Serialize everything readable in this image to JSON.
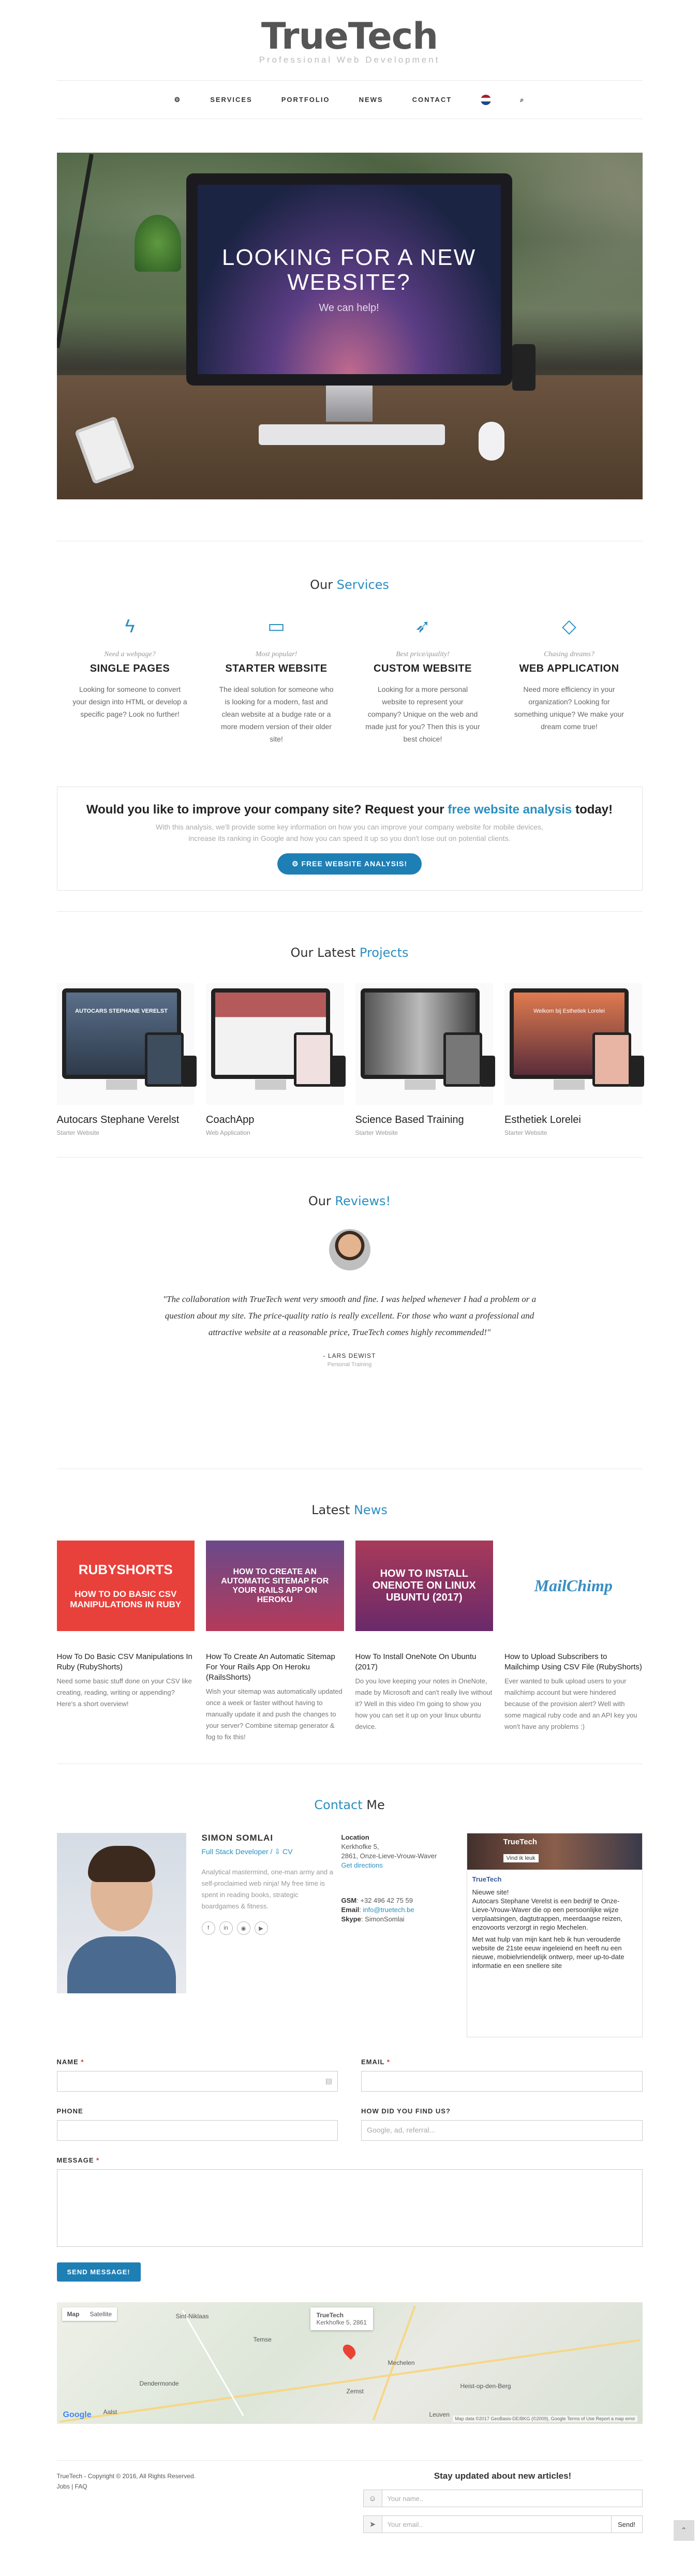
{
  "brand": {
    "logo": "TrueTech",
    "tagline": "Professional Web Development"
  },
  "nav": {
    "items": [
      "SERVICES",
      "PORTFOLIO",
      "NEWS",
      "CONTACT"
    ]
  },
  "hero": {
    "title": "LOOKING FOR A NEW WEBSITE?",
    "subtitle": "We can help!"
  },
  "services": {
    "title": "Our",
    "title_hl": "Services",
    "items": [
      {
        "icon": "bolt-icon",
        "sub": "Need a webpage?",
        "title": "SINGLE PAGES",
        "text": "Looking for someone to convert your design into HTML or develop a specific page? Look no further!"
      },
      {
        "icon": "monitor-icon",
        "sub": "Most popular!",
        "title": "STARTER WEBSITE",
        "text": "The ideal solution for someone who is looking for a modern, fast and clean website at a budge rate or a more modern version of their older site!"
      },
      {
        "icon": "rocket-icon",
        "sub": "Best price/quality!",
        "title": "CUSTOM WEBSITE",
        "text": "Looking for a more personal website to represent your company? Unique on the web and made just for you? Then this is your best choice!"
      },
      {
        "icon": "diamond-icon",
        "sub": "Chasing dreams?",
        "title": "WEB APPLICATION",
        "text": "Need more efficiency in your organization? Looking for something unique? We make your dream come true!"
      }
    ]
  },
  "cta": {
    "q1": "Would you like to improve your company site? Request your",
    "q_hl": "free website analysis",
    "q2": "today!",
    "desc": "With this analysis, we'll provide some key information on how you can improve your company website for mobile devices, increase its ranking in Google and how you can speed it up so you don't lose out on potential clients.",
    "button": "FREE WEBSITE ANALYSIS!"
  },
  "projects": {
    "title": "Our Latest",
    "title_hl": "Projects",
    "items": [
      {
        "name": "Autocars Stephane Verelst",
        "cat": "Starter Website",
        "screen": "AUTOCARS STEPHANE VERELST"
      },
      {
        "name": "CoachApp",
        "cat": "Web Application",
        "screen": ""
      },
      {
        "name": "Science Based Training",
        "cat": "Starter Website",
        "screen": ""
      },
      {
        "name": "Esthetiek Lorelei",
        "cat": "Starter Website",
        "screen": "Welkom bij Esthetiek Lorelei"
      }
    ]
  },
  "reviews": {
    "title": "Our",
    "title_hl": "Reviews!",
    "quote": "\"The collaboration with TrueTech went very smooth and fine. I was helped whenever I had a problem or a question about my site. The price-quality ratio is really excellent. For those who want a professional and attractive website at a reasonable price, TrueTech comes highly recommended!\"",
    "name": "- LARS DEWIST",
    "role": "Personal Training"
  },
  "news": {
    "title": "Latest",
    "title_hl": "News",
    "items": [
      {
        "img1": "RUBYSHORTS",
        "img2": "HOW TO DO BASIC CSV MANIPULATIONS IN RUBY",
        "title": "How To Do Basic CSV Manipulations In Ruby (RubyShorts)",
        "text": "Need some basic stuff done on your CSV like creating, reading, writing or appending? Here's a short overview!"
      },
      {
        "img1": "HOW TO CREATE AN AUTOMATIC SITEMAP FOR YOUR RAILS APP ON HEROKU",
        "img2": "",
        "title": "How To Create An Automatic Sitemap For Your Rails App On Heroku (RailsShorts)",
        "text": "Wish your sitemap was automatically updated once a week or faster without having to manually update it and push the changes to your server? Combine sitemap generator & fog to fix this!"
      },
      {
        "img1": "HOW TO INSTALL ONENOTE ON LINUX UBUNTU (2017)",
        "img2": "",
        "title": "How To Install OneNote On Ubuntu (2017)",
        "text": "Do you love keeping your notes in OneNote, made by Microsoft and can't really live without it? Well in this video I'm going to show you how you can set it up on your linux ubuntu device."
      },
      {
        "img1": "MailChimp",
        "img2": "",
        "title": "How to Upload Subscribers to Mailchimp Using CSV File (RubyShorts)",
        "text": "Ever wanted to bulk upload users to your mailchimp account but were hindered because of the provision alert? Well with some magical ruby code and an API key you won't have any problems :)"
      }
    ]
  },
  "contact": {
    "title": "Contact",
    "title_hl": "Me",
    "name": "SIMON SOMLAI",
    "role": "Full Stack Developer",
    "cv": "CV",
    "bio": "Analytical mastermind, one-man army and a self-proclaimed web ninja! My free time is spent in reading books, strategic boardgames & fitness.",
    "location_label": "Location",
    "address1": "Kerkhofke 5,",
    "address2": "2861, Onze-Lieve-Vrouw-Waver",
    "directions": "Get directions",
    "gsm_label": "GSM",
    "gsm": "+32 496 42 75 59",
    "email_label": "Email",
    "email": "info@truetech.be",
    "skype_label": "Skype",
    "skype": "SimonSomlai",
    "fb_title": "TrueTech",
    "fb_like": "Vind ik leuk",
    "fb_page": "TrueTech",
    "fb_text1": "Nieuwe site!",
    "fb_text2": "Autocars Stephane Verelst is een bedrijf te Onze-Lieve-Vrouw-Waver die op een persoonlijke wijze verplaatsingen, dagtutrappen, meerdaagse reizen, enzovoorts verzorgt in regio Mechelen.",
    "fb_text3": "Met wat hulp van mijn kant heb ik hun verouderde website de 21ste eeuw ingeleiend en heeft nu een nieuwe, mobielvriendelijk ontwerp, meer up-to-date informatie en een snellere site"
  },
  "form": {
    "name_label": "NAME",
    "email_label": "EMAIL",
    "phone_label": "PHONE",
    "found_label": "HOW DID YOU FIND US?",
    "found_placeholder": "Google, ad, referral...",
    "message_label": "MESSAGE",
    "required_mark": "*",
    "send": "SEND MESSAGE!"
  },
  "map": {
    "tab_map": "Map",
    "tab_sat": "Satellite",
    "bubble_title": "TrueTech",
    "bubble_text": "Kerkhofke 5, 2861",
    "towns": [
      "Sint-Niklaas",
      "Temse",
      "Dendermonde",
      "Aalst",
      "Mechelen",
      "Heist-op-den-Berg",
      "Leuven",
      "Zemst"
    ],
    "google": "Google",
    "attr": "Map data ©2017 GeoBasis-DE/BKG (©2009), Google   Terms of Use   Report a map error"
  },
  "footer": {
    "copyright": "TrueTech - Copyright © 2016, All Rights Reserved.",
    "links": "Jobs  |  FAQ",
    "newsletter_title": "Stay updated about new articles!",
    "name_placeholder": "Your name..",
    "email_placeholder": "Your email..",
    "send": "Send!"
  },
  "colors": {
    "accent": "#2a8fc1",
    "button": "#1e7fb5"
  }
}
